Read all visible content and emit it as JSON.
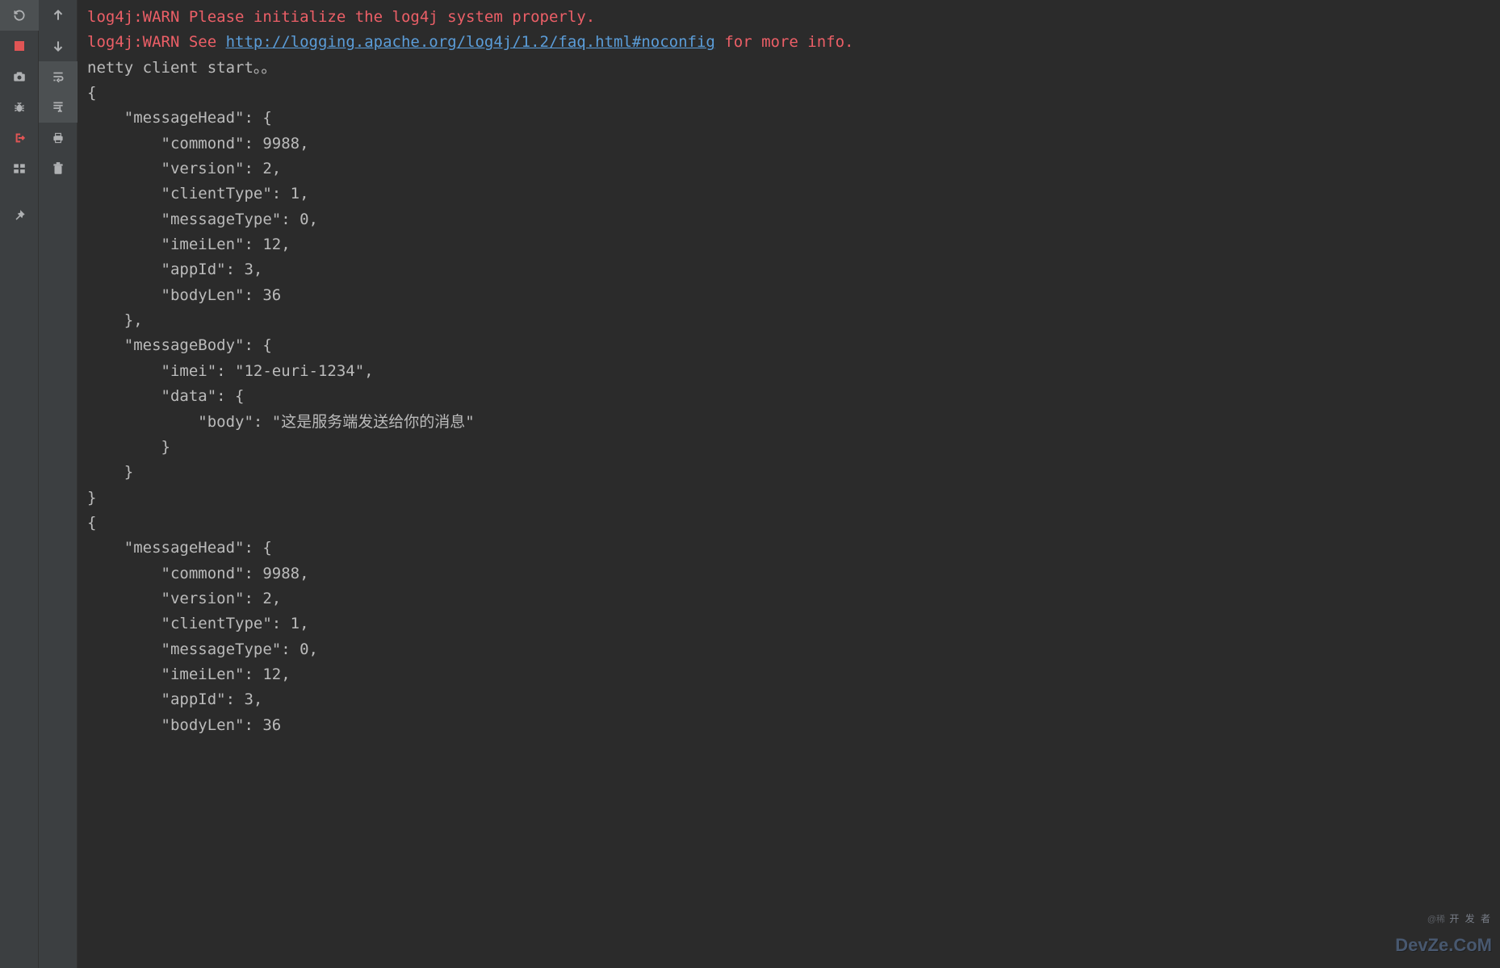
{
  "warn1_prefix": "log4j:WARN ",
  "warn1_text": "Please initialize the log4j system properly.",
  "warn2_prefix": "log4j:WARN ",
  "warn2_text_before": "See ",
  "warn2_link": "http://logging.apache.org/log4j/1.2/faq.html#noconfig",
  "warn2_text_after": " for more info.",
  "start_line": "netty client start。。",
  "json_lines": [
    "{",
    "    \"messageHead\": {",
    "        \"commond\": 9988,",
    "        \"version\": 2,",
    "        \"clientType\": 1,",
    "        \"messageType\": 0,",
    "        \"imeiLen\": 12,",
    "        \"appId\": 3,",
    "        \"bodyLen\": 36",
    "    },",
    "    \"messageBody\": {",
    "        \"imei\": \"12-euri-1234\",",
    "        \"data\": {",
    "            \"body\": \"这是服务端发送给你的消息\"",
    "        }",
    "    }",
    "}",
    "{",
    "    \"messageHead\": {",
    "        \"commond\": 9988,",
    "        \"version\": 2,",
    "        \"clientType\": 1,",
    "        \"messageType\": 0,",
    "        \"imeiLen\": 12,",
    "        \"appId\": 3,",
    "        \"bodyLen\": 36"
  ],
  "watermark_small": "@稀",
  "watermark_top": "开 发 者",
  "watermark_big": "DevZe.CoM"
}
